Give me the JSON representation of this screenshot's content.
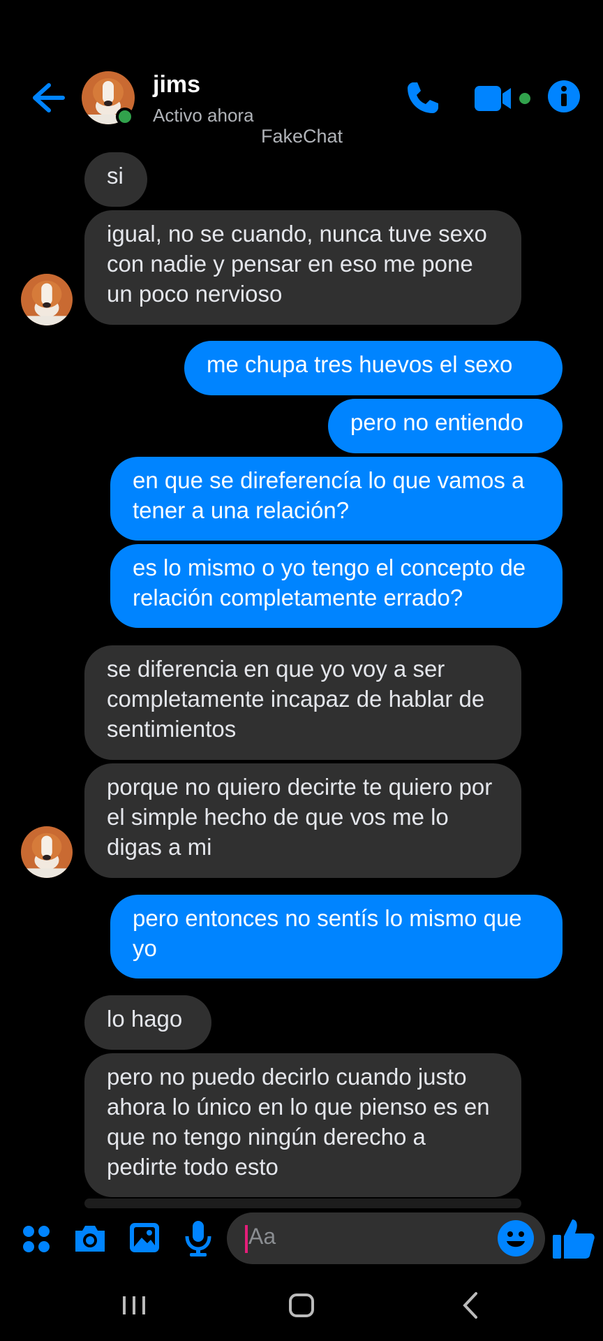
{
  "header": {
    "contact_name": "jims",
    "status": "Activo ahora",
    "watermark": "FakeChat"
  },
  "colors": {
    "accent": "#0084ff",
    "incoming_bubble": "#303030",
    "online": "#31a24c"
  },
  "icons": [
    "back-arrow-icon",
    "phone-icon",
    "video-camera-icon",
    "info-icon",
    "apps-icon",
    "camera-icon",
    "image-icon",
    "microphone-icon",
    "emoji-icon",
    "thumbs-up-icon"
  ],
  "messages": [
    {
      "from": "them",
      "text": "si"
    },
    {
      "from": "them",
      "text": "igual, no se cuando, nunca tuve sexo con nadie y pensar en eso me pone un poco nervioso"
    },
    {
      "from": "me",
      "text": "me chupa tres huevos el sexo"
    },
    {
      "from": "me",
      "text": "pero no entiendo"
    },
    {
      "from": "me",
      "text": "en que se direferencía lo que vamos a tener a una relación?"
    },
    {
      "from": "me",
      "text": "es lo mismo o yo tengo el concepto de relación completamente errado?"
    },
    {
      "from": "them",
      "text": "se diferencia en que yo voy a ser completamente incapaz de hablar de sentimientos"
    },
    {
      "from": "them",
      "text": "porque no quiero decirte te quiero por el simple hecho de que vos me lo digas a mi"
    },
    {
      "from": "me",
      "text": "pero entonces no sentís lo mismo que yo"
    },
    {
      "from": "them",
      "text": "lo hago"
    },
    {
      "from": "them",
      "text": "pero no puedo decirlo cuando justo ahora lo único en lo que pienso es en que no tengo ningún derecho a pedirte todo esto"
    }
  ],
  "composer": {
    "placeholder": "Aa"
  }
}
